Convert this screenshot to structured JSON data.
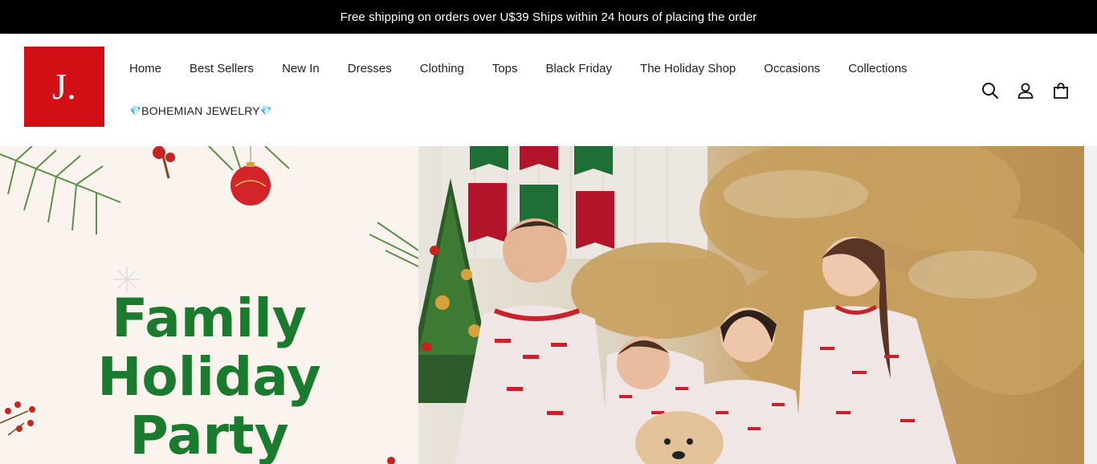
{
  "announcement": "Free shipping on orders over U$39 Ships within 24 hours of placing the order",
  "logo": {
    "text": "J."
  },
  "nav": {
    "items": [
      "Home",
      "Best Sellers",
      "New In",
      "Dresses",
      "Clothing",
      "Tops",
      "Black Friday",
      "The Holiday Shop",
      "Occasions",
      "Collections"
    ],
    "jewelry": "BOHEMIAN JEWELRY",
    "gem": "💎"
  },
  "icons": [
    "search-icon",
    "account-icon",
    "cart-icon"
  ],
  "banner": {
    "headline": [
      "Family",
      "Holiday",
      "Party"
    ],
    "headline_color": "#1a7a2e",
    "accent": "#d10f14"
  }
}
